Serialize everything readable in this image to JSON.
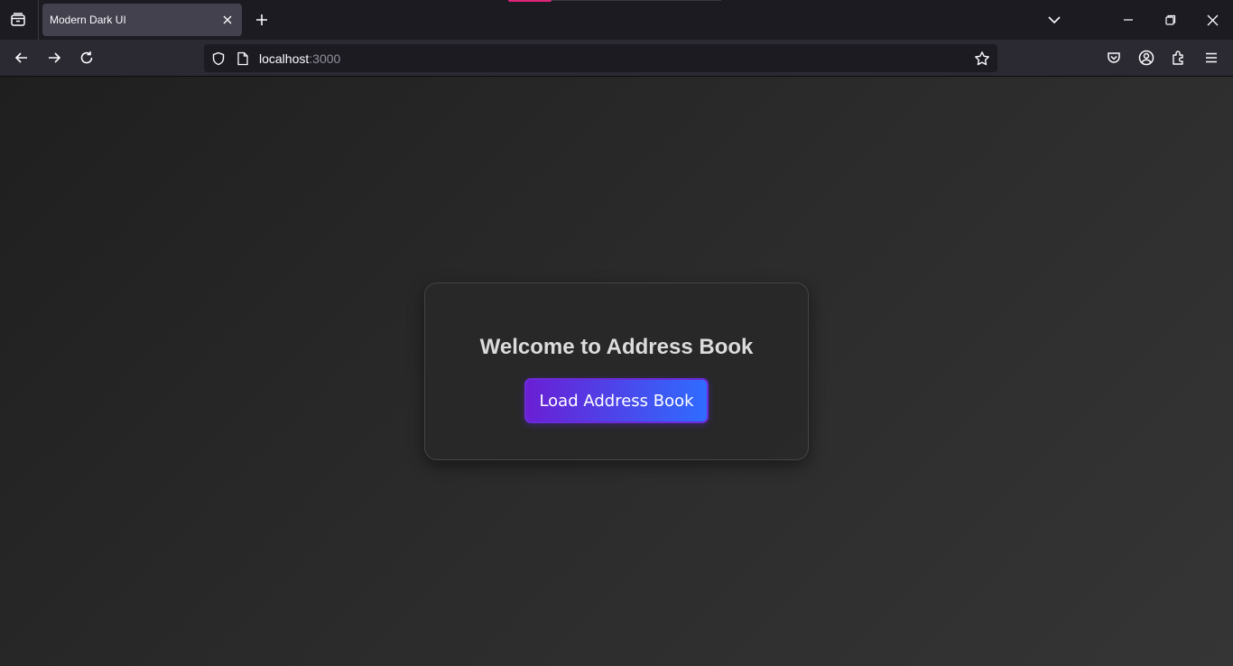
{
  "browser": {
    "tab": {
      "title": "Modern Dark UI",
      "close_icon": "close-icon"
    },
    "icons": {
      "tab_list": "tab-list-icon",
      "new_tab": "plus-icon",
      "tabs_overflow": "chevron-down-icon",
      "minimize": "minimize-icon",
      "restore": "restore-icon",
      "close_window": "close-icon",
      "back": "arrow-left-icon",
      "forward": "arrow-right-icon",
      "reload": "reload-icon",
      "shield": "shield-icon",
      "page": "page-icon",
      "bookmark": "star-icon",
      "pocket": "pocket-icon",
      "account": "account-icon",
      "extensions": "puzzle-icon",
      "menu": "hamburger-menu-icon"
    },
    "url": {
      "host": "localhost",
      "port": ":3000"
    },
    "colors": {
      "tab_accent": "#e0247a"
    }
  },
  "page": {
    "heading": "Welcome to Address Book",
    "load_button_label": "Load Address Book",
    "colors": {
      "button_gradient_start": "#6a1fd4",
      "button_gradient_end": "#2f6cff"
    }
  }
}
